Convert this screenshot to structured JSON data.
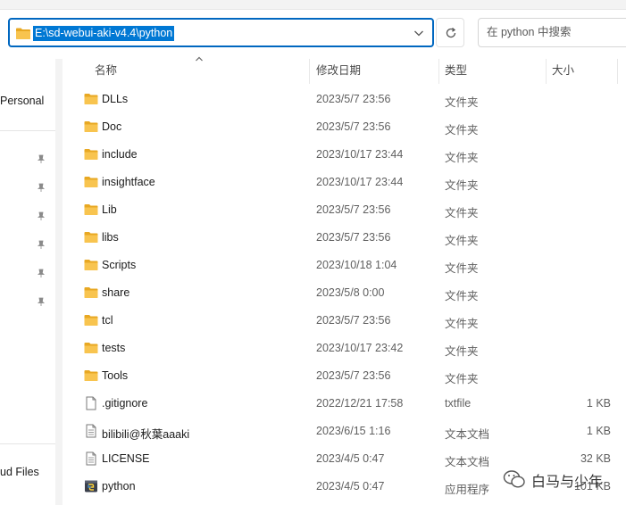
{
  "address": {
    "path": "E:\\sd-webui-aki-v4.4\\python"
  },
  "search": {
    "placeholder": "在 python 中搜索"
  },
  "nav": {
    "personal": "Personal",
    "cloud": "ud Files"
  },
  "columns": {
    "name": "名称",
    "date": "修改日期",
    "type": "类型",
    "size": "大小"
  },
  "files": [
    {
      "name": "DLLs",
      "date": "2023/5/7 23:56",
      "type": "文件夹",
      "size": "",
      "icon": "folder-icon"
    },
    {
      "name": "Doc",
      "date": "2023/5/7 23:56",
      "type": "文件夹",
      "size": "",
      "icon": "folder-icon"
    },
    {
      "name": "include",
      "date": "2023/10/17 23:44",
      "type": "文件夹",
      "size": "",
      "icon": "folder-icon"
    },
    {
      "name": "insightface",
      "date": "2023/10/17 23:44",
      "type": "文件夹",
      "size": "",
      "icon": "folder-icon"
    },
    {
      "name": "Lib",
      "date": "2023/5/7 23:56",
      "type": "文件夹",
      "size": "",
      "icon": "folder-icon"
    },
    {
      "name": "libs",
      "date": "2023/5/7 23:56",
      "type": "文件夹",
      "size": "",
      "icon": "folder-icon"
    },
    {
      "name": "Scripts",
      "date": "2023/10/18 1:04",
      "type": "文件夹",
      "size": "",
      "icon": "folder-icon"
    },
    {
      "name": "share",
      "date": "2023/5/8 0:00",
      "type": "文件夹",
      "size": "",
      "icon": "folder-icon"
    },
    {
      "name": "tcl",
      "date": "2023/5/7 23:56",
      "type": "文件夹",
      "size": "",
      "icon": "folder-icon"
    },
    {
      "name": "tests",
      "date": "2023/10/17 23:42",
      "type": "文件夹",
      "size": "",
      "icon": "folder-icon"
    },
    {
      "name": "Tools",
      "date": "2023/5/7 23:56",
      "type": "文件夹",
      "size": "",
      "icon": "folder-icon"
    },
    {
      "name": ".gitignore",
      "date": "2022/12/21 17:58",
      "type": "txtfile",
      "size": "1 KB",
      "icon": "file-icon"
    },
    {
      "name": "bilibili@秋葉aaaki",
      "date": "2023/6/15 1:16",
      "type": "文本文档",
      "size": "1 KB",
      "icon": "text-file-icon"
    },
    {
      "name": "LICENSE",
      "date": "2023/4/5 0:47",
      "type": "文本文档",
      "size": "32 KB",
      "icon": "text-file-icon"
    },
    {
      "name": "python",
      "date": "2023/4/5 0:47",
      "type": "应用程序",
      "size": "101 KB",
      "icon": "python-app-icon"
    }
  ],
  "watermark": {
    "text": "白马与少年"
  },
  "colors": {
    "accent": "#0078d4",
    "folder": "#f8c44f",
    "folder_dark": "#e8a823"
  }
}
